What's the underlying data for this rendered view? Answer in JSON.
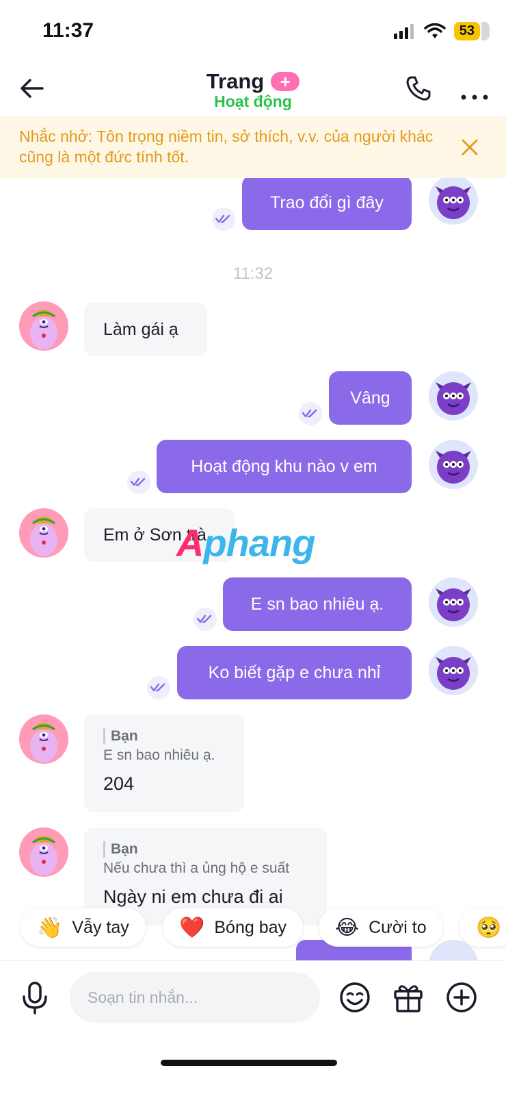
{
  "status_bar": {
    "time": "11:37",
    "battery": "53"
  },
  "header": {
    "contact_name": "Trang",
    "plus_badge": "+",
    "status": "Hoạt động"
  },
  "banner": {
    "text": "Nhắc nhở: Tôn trọng niềm tin, sở thích, v.v. của người khác cũng là một đức tính tốt."
  },
  "messages": [
    {
      "from": "me",
      "text": "Trao đổi gì đây"
    },
    {
      "type": "timestamp",
      "text": "11:32"
    },
    {
      "from": "her",
      "text": "Làm gái ạ"
    },
    {
      "from": "me",
      "text": "Vâng"
    },
    {
      "from": "me",
      "text": "Hoạt động khu nào v em"
    },
    {
      "from": "her",
      "text": "Em ở Sơn trà"
    },
    {
      "from": "me",
      "text": "E sn bao nhiêu ạ."
    },
    {
      "from": "me",
      "text": "Ko biết gặp e chưa nhỉ"
    },
    {
      "from": "her",
      "quote_name": "Bạn",
      "quote_text": "E sn bao nhiêu ạ.",
      "text": "204"
    },
    {
      "from": "her",
      "quote_name": "Bạn",
      "quote_text": "Nếu chưa thì a ủng hộ e suất",
      "text": "Ngày ni em chưa đi ai"
    }
  ],
  "watermark": {
    "part1": "A",
    "part2": "phang"
  },
  "quick_replies": [
    {
      "emoji": "👋",
      "label": "Vẫy tay"
    },
    {
      "emoji": "❤️",
      "label": "Bóng bay"
    },
    {
      "emoji": "😂",
      "label": "Cười to"
    },
    {
      "emoji": "🥺",
      "label": ""
    }
  ],
  "composer": {
    "placeholder": "Soạn tin nhắn..."
  },
  "colors": {
    "sent_bubble": "#8a6ae8",
    "online_green": "#28c44a",
    "banner_text": "#e39a1c",
    "banner_bg": "#fff7e6"
  }
}
